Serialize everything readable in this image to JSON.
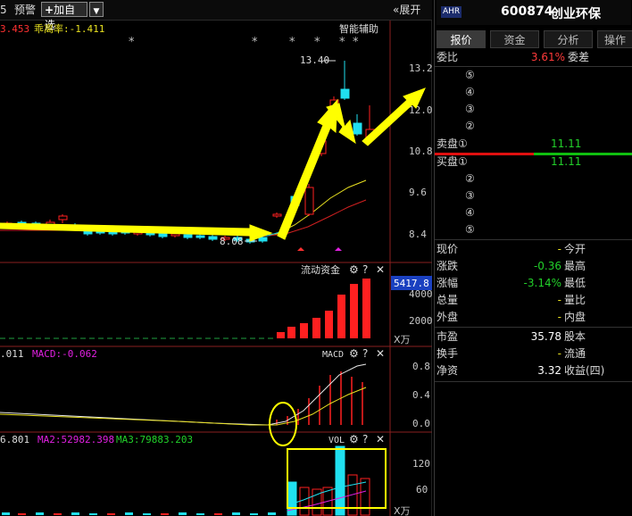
{
  "toolbar": {
    "left_partial": "5",
    "alert_label": "预警",
    "add_favorite_label": "加自选",
    "expand_label": "展开"
  },
  "chart": {
    "indicator_partial": "3.453",
    "bias_label": "乖离率:-1.411",
    "smart_assist": "智能辅助",
    "high_label": "13.40",
    "low_label": "8.08",
    "price_axis": [
      "13.2",
      "12.0",
      "10.8",
      "9.6",
      "8.4"
    ],
    "funds_title": "流动资金",
    "funds_current": "5417.8",
    "funds_axis": [
      "4000",
      "2000"
    ],
    "funds_unit": "X万",
    "macd_left": ".011",
    "macd_value": "MACD:-0.062",
    "macd_title": "MACD",
    "macd_axis": [
      "0.8",
      "0.4",
      "0.0"
    ],
    "vol_partial": "6.801",
    "vol_ma2": "MA2:52982.398",
    "vol_ma3": "MA3:79883.203",
    "vol_title": "VOL",
    "vol_axis": [
      "120",
      "60"
    ],
    "vol_unit": "X万",
    "colors": {
      "up": "#ff2020",
      "down": "#20e0f0",
      "annotation": "#ffff00"
    }
  },
  "panel": {
    "badge": "AHR",
    "code": "600874",
    "name": "创业环保",
    "tabs": [
      "报价",
      "资金",
      "分析",
      "操作"
    ],
    "weibi_label": "委比",
    "weibi_value": "3.61%",
    "weicha_label": "委差",
    "sell_levels": [
      "⑤",
      "④",
      "③",
      "②"
    ],
    "sell1_label": "卖盘①",
    "sell1_price": "11.11",
    "buy1_label": "买盘①",
    "buy1_price": "11.11",
    "buy_levels": [
      "②",
      "③",
      "④",
      "⑤"
    ],
    "stats": [
      {
        "l1": "现价",
        "v1": "-",
        "l2": "今开",
        "v2": ""
      },
      {
        "l1": "涨跌",
        "v1": "-0.36",
        "l2": "最高",
        "v2": ""
      },
      {
        "l1": "涨幅",
        "v1": "-3.14%",
        "l2": "最低",
        "v2": ""
      },
      {
        "l1": "总量",
        "v1": "-",
        "l2": "量比",
        "v2": ""
      },
      {
        "l1": "外盘",
        "v1": "-",
        "l2": "内盘",
        "v2": ""
      }
    ],
    "stats2": [
      {
        "l1": "市盈",
        "v1": "35.78",
        "l2": "股本",
        "v2": ""
      },
      {
        "l1": "换手",
        "v1": "-",
        "l2": "流通",
        "v2": ""
      },
      {
        "l1": "净资",
        "v1": "3.32",
        "l2": "收益(四)",
        "v2": ""
      }
    ]
  }
}
